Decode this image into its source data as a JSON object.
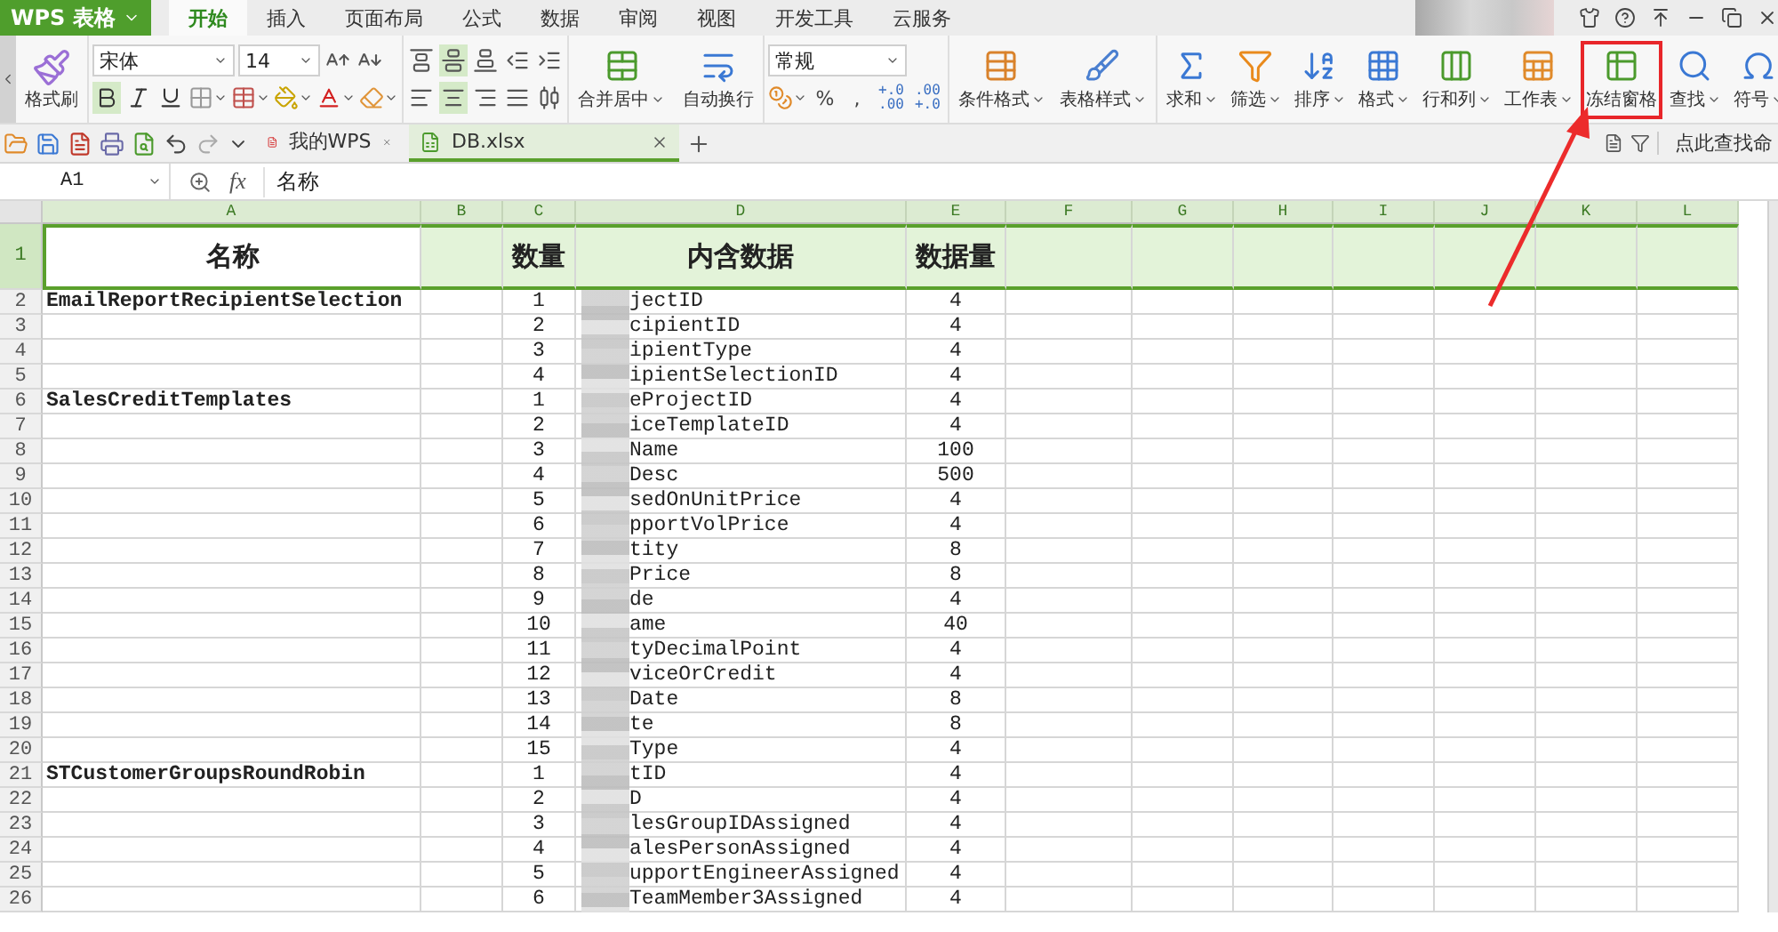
{
  "app_button": {
    "label": "WPS 表格"
  },
  "ribbon_tabs": [
    {
      "label": "开始",
      "selected": true
    },
    {
      "label": "插入",
      "selected": false
    },
    {
      "label": "页面布局",
      "selected": false
    },
    {
      "label": "公式",
      "selected": false
    },
    {
      "label": "数据",
      "selected": false
    },
    {
      "label": "审阅",
      "selected": false
    },
    {
      "label": "视图",
      "selected": false
    },
    {
      "label": "开发工具",
      "selected": false
    },
    {
      "label": "云服务",
      "selected": false
    }
  ],
  "ribbon": {
    "format_painter": "格式刷",
    "font_name": "宋体",
    "font_size": "14",
    "bold": true,
    "italic": false,
    "underline": false,
    "vertical_align": [
      {
        "kind": "top",
        "selected": false
      },
      {
        "kind": "middle",
        "selected": true
      },
      {
        "kind": "bottom",
        "selected": false
      }
    ],
    "horizontal_align": [
      {
        "kind": "left",
        "selected": false
      },
      {
        "kind": "center",
        "selected": true
      },
      {
        "kind": "right",
        "selected": false
      },
      {
        "kind": "justify",
        "selected": false
      },
      {
        "kind": "distributed",
        "selected": false
      }
    ],
    "merge_button": {
      "label": "合并居中",
      "dropdown": true
    },
    "wrap_button": {
      "label": "自动换行",
      "dropdown": false
    },
    "number_format": "常规",
    "percent": "%",
    "comma": ",",
    "increase_decimal": [
      "+.0",
      ".00"
    ],
    "decrease_decimal": [
      ".00",
      "+.0"
    ],
    "style_buttons": [
      {
        "kind": "conditional",
        "label": "条件格式",
        "dropdown": true,
        "highlighted": false
      },
      {
        "kind": "table-style",
        "label": "表格样式",
        "dropdown": true,
        "highlighted": false
      }
    ],
    "tool_buttons": [
      {
        "kind": "sum",
        "label": "求和",
        "dropdown": true,
        "highlighted": false
      },
      {
        "kind": "filter",
        "label": "筛选",
        "dropdown": true,
        "highlighted": false
      },
      {
        "kind": "sort",
        "label": "排序",
        "dropdown": true,
        "highlighted": false
      },
      {
        "kind": "format",
        "label": "格式",
        "dropdown": true,
        "highlighted": false
      },
      {
        "kind": "rows-cols",
        "label": "行和列",
        "dropdown": true,
        "highlighted": false
      },
      {
        "kind": "sheet",
        "label": "工作表",
        "dropdown": true,
        "highlighted": false
      },
      {
        "kind": "freeze",
        "label": "冻结窗格",
        "dropdown": false,
        "highlighted": true
      },
      {
        "kind": "find",
        "label": "查找",
        "dropdown": true,
        "highlighted": false
      },
      {
        "kind": "symbol",
        "label": "符号",
        "dropdown": true,
        "highlighted": false
      }
    ]
  },
  "doc_tabs": [
    {
      "label": "我的WPS",
      "kind": "home",
      "selected": false
    },
    {
      "label": "DB.xlsx",
      "kind": "sheet",
      "selected": true
    }
  ],
  "command_search": {
    "placeholder": "点此查找命"
  },
  "formula_bar": {
    "cell_ref": "A1",
    "fx": "fx",
    "value": "名称"
  },
  "sheet": {
    "columns": [
      "A",
      "B",
      "C",
      "D",
      "E",
      "F",
      "G",
      "H",
      "I",
      "J",
      "K",
      "L"
    ],
    "rows": [
      {
        "number": "1",
        "kind": "header",
        "selected": true,
        "name": "名称",
        "count": "数量",
        "field": "内含数据",
        "size": "数据量"
      },
      {
        "number": "2",
        "kind": "data",
        "selected": false,
        "name": "EmailReportRecipientSelection",
        "count": "1",
        "field": "jectID",
        "size": "4"
      },
      {
        "number": "3",
        "kind": "data",
        "selected": false,
        "count": "2",
        "field": "cipientID",
        "size": "4"
      },
      {
        "number": "4",
        "kind": "data",
        "selected": false,
        "count": "3",
        "field": "ipientType",
        "size": "4"
      },
      {
        "number": "5",
        "kind": "data",
        "selected": false,
        "count": "4",
        "field": "ipientSelectionID",
        "size": "4"
      },
      {
        "number": "6",
        "kind": "data",
        "selected": false,
        "name": "SalesCreditTemplates",
        "count": "1",
        "field": "eProjectID",
        "size": "4"
      },
      {
        "number": "7",
        "kind": "data",
        "selected": false,
        "count": "2",
        "field": "iceTemplateID",
        "size": "4"
      },
      {
        "number": "8",
        "kind": "data",
        "selected": false,
        "count": "3",
        "field": "Name",
        "size": "100"
      },
      {
        "number": "9",
        "kind": "data",
        "selected": false,
        "count": "4",
        "field": "Desc",
        "size": "500"
      },
      {
        "number": "10",
        "kind": "data",
        "selected": false,
        "count": "5",
        "field": "sedOnUnitPrice",
        "size": "4"
      },
      {
        "number": "11",
        "kind": "data",
        "selected": false,
        "count": "6",
        "field": "pportVolPrice",
        "size": "4"
      },
      {
        "number": "12",
        "kind": "data",
        "selected": false,
        "count": "7",
        "field": "tity",
        "size": "8"
      },
      {
        "number": "13",
        "kind": "data",
        "selected": false,
        "count": "8",
        "field": "Price",
        "size": "8"
      },
      {
        "number": "14",
        "kind": "data",
        "selected": false,
        "count": "9",
        "field": "de",
        "size": "4"
      },
      {
        "number": "15",
        "kind": "data",
        "selected": false,
        "count": "10",
        "field": "ame",
        "size": "40"
      },
      {
        "number": "16",
        "kind": "data",
        "selected": false,
        "count": "11",
        "field": "tyDecimalPoint",
        "size": "4"
      },
      {
        "number": "17",
        "kind": "data",
        "selected": false,
        "count": "12",
        "field": "viceOrCredit",
        "size": "4"
      },
      {
        "number": "18",
        "kind": "data",
        "selected": false,
        "count": "13",
        "field": "Date",
        "size": "8"
      },
      {
        "number": "19",
        "kind": "data",
        "selected": false,
        "count": "14",
        "field": "te",
        "size": "8"
      },
      {
        "number": "20",
        "kind": "data",
        "selected": false,
        "count": "15",
        "field": "Type",
        "size": "4"
      },
      {
        "number": "21",
        "kind": "data",
        "selected": false,
        "name": "STCustomerGroupsRoundRobin",
        "count": "1",
        "field": "tID",
        "size": "4"
      },
      {
        "number": "22",
        "kind": "data",
        "selected": false,
        "count": "2",
        "field": "D",
        "size": "4"
      },
      {
        "number": "23",
        "kind": "data",
        "selected": false,
        "count": "3",
        "field": "lesGroupIDAssigned",
        "size": "4"
      },
      {
        "number": "24",
        "kind": "data",
        "selected": false,
        "count": "4",
        "field": "alesPersonAssigned",
        "size": "4"
      },
      {
        "number": "25",
        "kind": "data",
        "selected": false,
        "count": "5",
        "field": "upportEngineerAssigned",
        "size": "4"
      },
      {
        "number": "26",
        "kind": "data",
        "selected": false,
        "count": "6",
        "field": "TeamMember3Assigned",
        "size": "4"
      }
    ]
  }
}
